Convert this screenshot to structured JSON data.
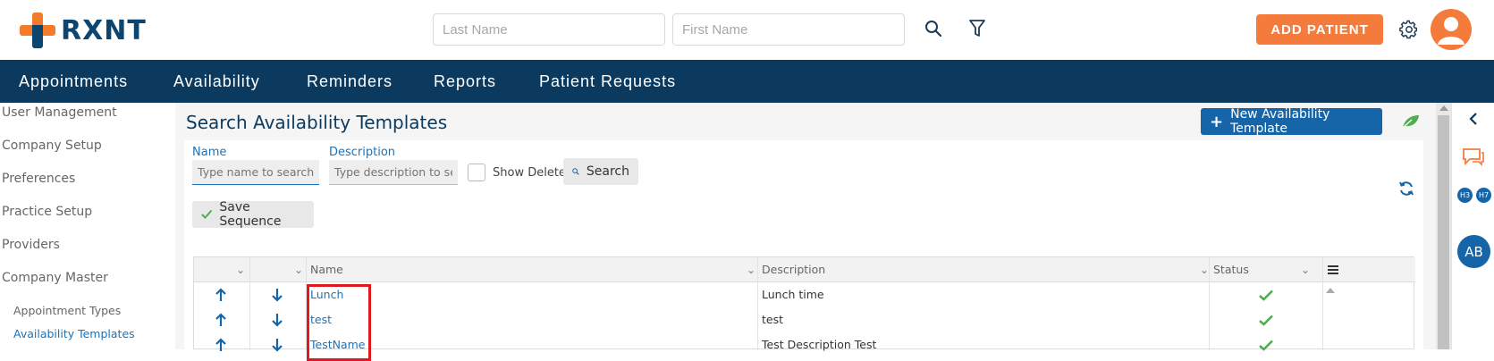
{
  "app": {
    "logo_text": "RXNT",
    "brand_orange": "#f47b3c",
    "brand_navy": "#0c3a5e"
  },
  "header": {
    "last_name_placeholder": "Last Name",
    "first_name_placeholder": "First Name",
    "search_icon": "search-icon",
    "filter_icon": "filter-icon",
    "add_patient_label": "ADD PATIENT",
    "settings_icon": "gear-icon",
    "user_icon": "user-avatar-icon"
  },
  "nav": {
    "items": [
      {
        "label": "Appointments"
      },
      {
        "label": "Availability"
      },
      {
        "label": "Reminders"
      },
      {
        "label": "Reports"
      },
      {
        "label": "Patient Requests"
      }
    ]
  },
  "sidebar": {
    "items": [
      {
        "label": "User Management"
      },
      {
        "label": "Company Setup"
      },
      {
        "label": "Preferences"
      },
      {
        "label": "Practice Setup"
      },
      {
        "label": "Providers"
      },
      {
        "label": "Company Master"
      }
    ],
    "subitems": [
      {
        "label": "Appointment Types",
        "active": false
      },
      {
        "label": "Availability Templates",
        "active": true
      }
    ]
  },
  "main": {
    "title": "Search Availability Templates",
    "new_template_label": "New Availability Template",
    "form": {
      "name_label": "Name",
      "name_placeholder": "Type name to search",
      "description_label": "Description",
      "description_placeholder": "Type description to search",
      "show_deleted_label": "Show Deleted",
      "show_deleted_checked": false,
      "search_label": "Search",
      "save_sequence_label": "Save Sequence"
    },
    "table": {
      "columns": [
        "Name",
        "Description",
        "Status"
      ],
      "rows": [
        {
          "name": "Lunch",
          "description": "Lunch time",
          "status": "active"
        },
        {
          "name": "test",
          "description": "test",
          "status": "active"
        },
        {
          "name": "TestName",
          "description": "Test Description Test",
          "status": "active"
        }
      ]
    }
  },
  "rightrail": {
    "badges": [
      "H3",
      "H7"
    ],
    "avatar_initials": "AB"
  }
}
